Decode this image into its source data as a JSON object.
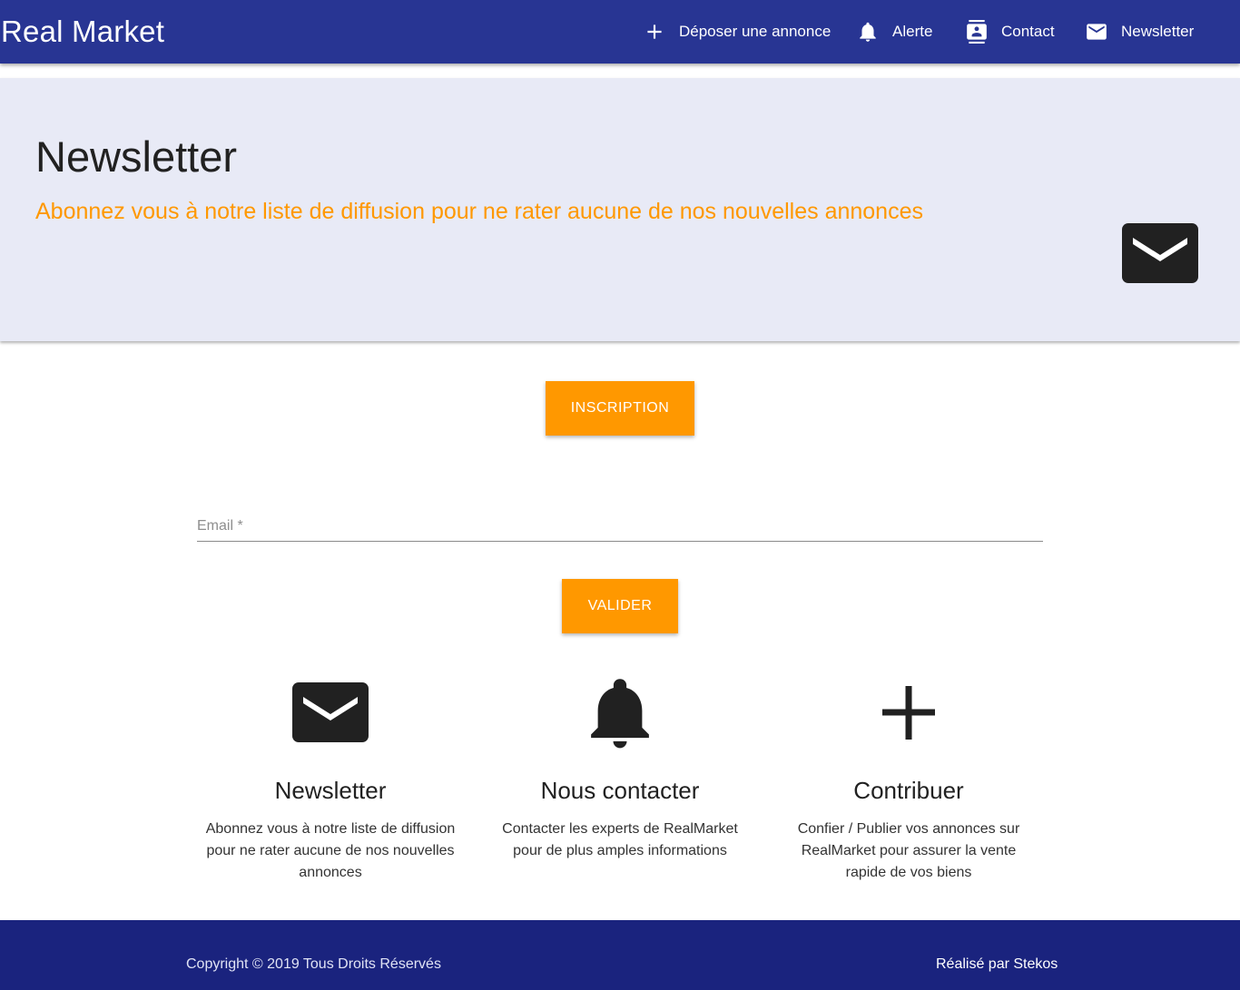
{
  "navbar": {
    "brand": "Real Market",
    "items": [
      {
        "label": "Déposer une annonce",
        "icon": "plus-icon"
      },
      {
        "label": "Alerte",
        "icon": "bell-icon"
      },
      {
        "label": "Contact",
        "icon": "contact-card-icon"
      },
      {
        "label": "Newsletter",
        "icon": "mail-icon"
      }
    ]
  },
  "hero": {
    "title": "Newsletter",
    "subtitle": "Abonnez vous à notre liste de diffusion pour ne rater aucune de nos nouvelles annonces",
    "icon": "mail-icon"
  },
  "form": {
    "inscription_label": "INSCRIPTION",
    "email_placeholder": "Email *",
    "email_value": "",
    "valider_label": "VALIDER"
  },
  "features": [
    {
      "icon": "mail-icon",
      "title": "Newsletter",
      "text": "Abonnez vous à notre liste de diffusion pour ne rater aucune de nos nouvelles annonces"
    },
    {
      "icon": "bell-icon",
      "title": "Nous contacter",
      "text": "Contacter les experts de RealMarket pour de plus amples informations"
    },
    {
      "icon": "plus-icon",
      "title": "Contribuer",
      "text": "Confier / Publier vos annonces sur RealMarket pour assurer la vente rapide de vos biens"
    }
  ],
  "footer": {
    "copyright": "Copyright © 2019 Tous Droits Réservés",
    "credit": "Réalisé par Stekos"
  },
  "colors": {
    "navbar": "#283593",
    "accent": "#ff9800",
    "hero_bg": "#e8eaf6",
    "footer": "#1a237e"
  }
}
